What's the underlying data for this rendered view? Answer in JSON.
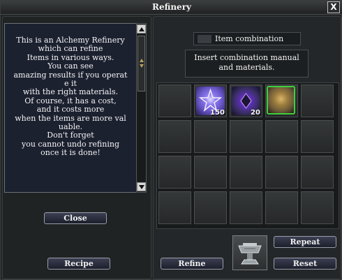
{
  "window": {
    "title": "Refinery",
    "close_label": "X"
  },
  "description": {
    "lines": [
      "This is an Alchemy Refinery",
      "which can refine",
      "Items in various ways.",
      "You can see",
      "amazing results if you operat",
      "e it",
      "with the right materials.",
      "Of course, it has a cost,",
      "and it costs more",
      "when the items are more val",
      "uable.",
      "Don't forget",
      "you cannot undo refining",
      "once it is done!"
    ]
  },
  "buttons": {
    "close": "Close",
    "recipe": "Recipe",
    "refine": "Refine",
    "repeat": "Repeat",
    "reset": "Reset"
  },
  "combination": {
    "label": "Item combination",
    "instruction_line1": "Insert combination manual",
    "instruction_line2": "and materials."
  },
  "grid": {
    "rows": 4,
    "cols": 5,
    "items": [
      {
        "slot": 1,
        "icon": "star-crystal-icon",
        "count": "150",
        "color": "#6a57c8"
      },
      {
        "slot": 2,
        "icon": "dark-orb-icon",
        "count": "20",
        "color": "#3a2f66"
      },
      {
        "slot": 3,
        "icon": "armor-piece-icon",
        "count": "",
        "color": "#6b5a3a"
      }
    ]
  },
  "colors": {
    "border_highlight": "#3fcf3f"
  }
}
